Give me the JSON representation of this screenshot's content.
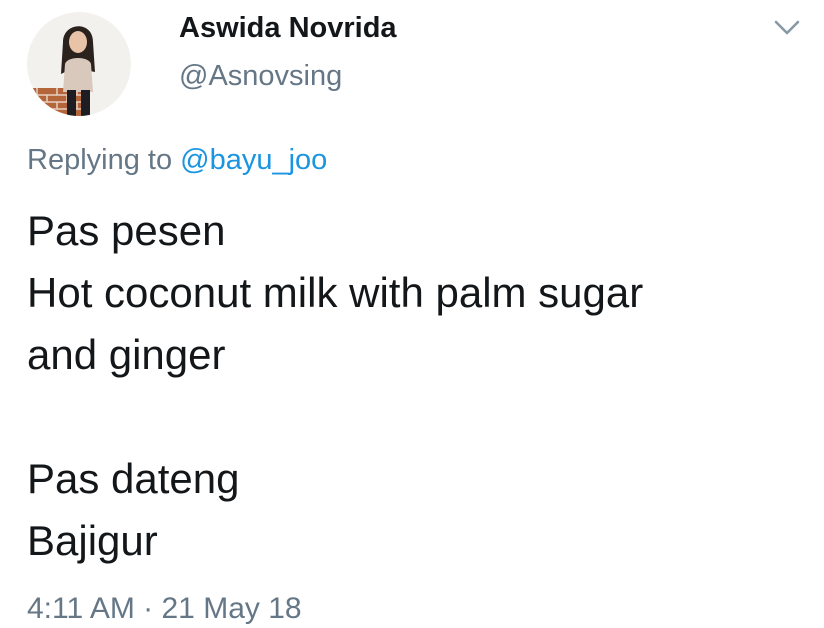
{
  "tweet": {
    "author": {
      "display_name": "Aswida Novrida",
      "handle": "@Asnovsing",
      "avatar_icon": "profile-photo"
    },
    "menu_icon": "chevron-down-icon",
    "reply": {
      "prefix": "Replying to",
      "mention": "@bayu_joo"
    },
    "text_lines": [
      "Pas pesen",
      "Hot coconut milk with palm sugar",
      "and ginger",
      "",
      "Pas dateng",
      "Bajigur"
    ],
    "timestamp": "4:11 AM · 21 May 18"
  },
  "colors": {
    "text": "#14171a",
    "secondary": "#657786",
    "link": "#1b95e0"
  }
}
